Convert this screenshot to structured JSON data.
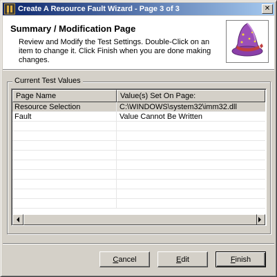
{
  "window": {
    "title": "Create A Resource Fault Wizard - Page 3 of 3",
    "close_glyph": "✕"
  },
  "header": {
    "title": "Summary / Modification Page",
    "description": "Review and Modify the Test Settings. Double-Click on an item to change it.  Click Finish when you are done making changes.",
    "image_icon": "wizard-hat-icon"
  },
  "group": {
    "label": "Current Test Values"
  },
  "table": {
    "columns": [
      "Page Name",
      "Value(s) Set On Page:"
    ],
    "rows": [
      {
        "name": "Resource Selection",
        "value": "C:\\WINDOWS\\system32\\imm32.dll",
        "selected": true
      },
      {
        "name": "Fault",
        "value": "Value Cannot Be Written",
        "selected": false
      }
    ]
  },
  "buttons": {
    "cancel_mnemonic": "C",
    "cancel_rest": "ancel",
    "edit_mnemonic": "E",
    "edit_rest": "dit",
    "finish_mnemonic": "F",
    "finish_rest": "inish"
  },
  "colors": {
    "titlebar_start": "#0a246a",
    "titlebar_end": "#a6caf0",
    "face": "#d4d0c8"
  }
}
